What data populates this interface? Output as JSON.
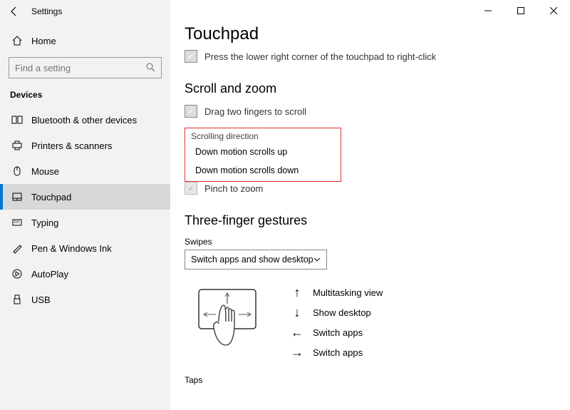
{
  "titlebar": {
    "title": "Settings"
  },
  "home": {
    "label": "Home"
  },
  "search": {
    "placeholder": "Find a setting"
  },
  "group": "Devices",
  "nav": [
    {
      "label": "Bluetooth & other devices"
    },
    {
      "label": "Printers & scanners"
    },
    {
      "label": "Mouse"
    },
    {
      "label": "Touchpad"
    },
    {
      "label": "Typing"
    },
    {
      "label": "Pen & Windows Ink"
    },
    {
      "label": "AutoPlay"
    },
    {
      "label": "USB"
    }
  ],
  "page": {
    "title": "Touchpad",
    "check_rightclick": "Press the lower right corner of the touchpad to right-click",
    "scroll_zoom": "Scroll and zoom",
    "check_drag": "Drag two fingers to scroll",
    "scroll_dir_label": "Scrolling direction",
    "scroll_options": [
      "Down motion scrolls up",
      "Down motion scrolls down"
    ],
    "pinch": "Pinch to zoom",
    "three_finger": "Three-finger gestures",
    "swipes_label": "Swipes",
    "swipes_value": "Switch apps and show desktop",
    "gestures": [
      {
        "arrow": "↑",
        "text": "Multitasking view"
      },
      {
        "arrow": "↓",
        "text": "Show desktop"
      },
      {
        "arrow": "←",
        "text": "Switch apps"
      },
      {
        "arrow": "→",
        "text": "Switch apps"
      }
    ],
    "taps": "Taps"
  }
}
